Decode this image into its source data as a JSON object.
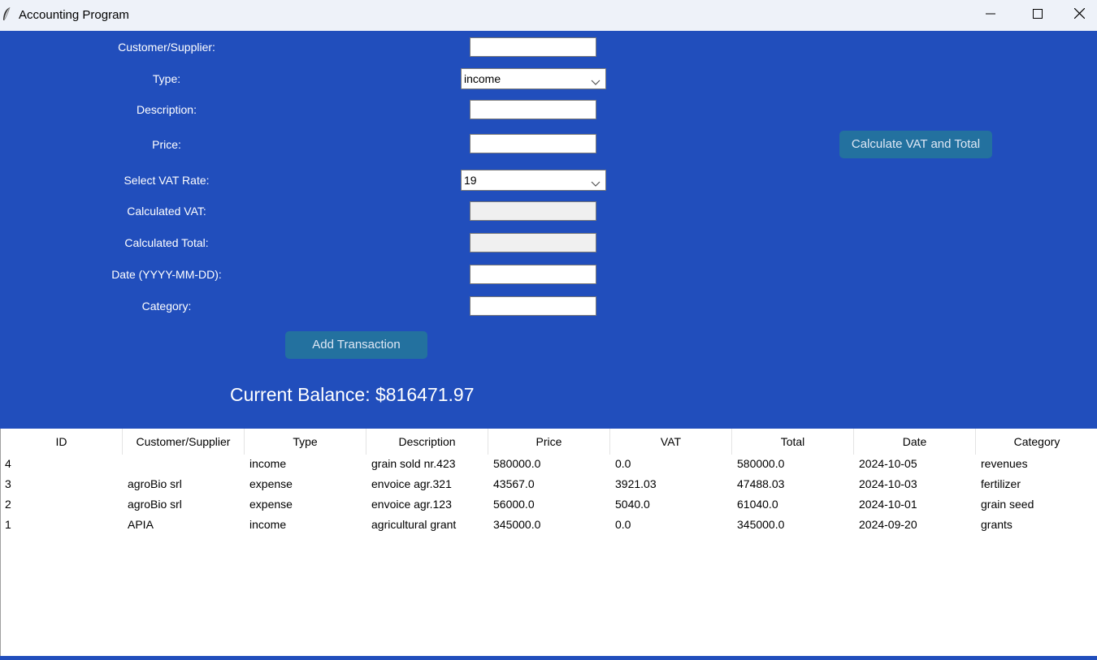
{
  "window": {
    "title": "Accounting Program",
    "icons": {
      "app": "feather-icon",
      "minimize": "minimize-icon",
      "maximize": "maximize-icon",
      "close": "close-icon"
    }
  },
  "colors": {
    "panel": "#214ebc",
    "button": "#23719f",
    "button_text": "#dfe8f5"
  },
  "form": {
    "customer_label": "Customer/Supplier:",
    "customer_value": "",
    "type_label": "Type:",
    "type_value": "income",
    "description_label": "Description:",
    "description_value": "",
    "price_label": "Price:",
    "price_value": "",
    "vat_rate_label": "Select VAT Rate:",
    "vat_rate_value": "19",
    "calc_vat_label": "Calculated VAT:",
    "calc_vat_value": "",
    "calc_total_label": "Calculated Total:",
    "calc_total_value": "",
    "date_label": "Date (YYYY-MM-DD):",
    "date_value": "",
    "category_label": "Category:",
    "category_value": "",
    "add_button": "Add Transaction",
    "calc_button": "Calculate VAT and Total",
    "balance": "Current Balance: $816471.97"
  },
  "table": {
    "columns": [
      "ID",
      "Customer/Supplier",
      "Type",
      "Description",
      "Price",
      "VAT",
      "Total",
      "Date",
      "Category"
    ],
    "rows": [
      [
        "4",
        "",
        "income",
        "grain sold nr.423",
        "580000.0",
        "0.0",
        "580000.0",
        "2024-10-05",
        "revenues"
      ],
      [
        "3",
        "agroBio srl",
        "expense",
        "envoice agr.321",
        "43567.0",
        "3921.03",
        "47488.03",
        "2024-10-03",
        "fertilizer"
      ],
      [
        "2",
        "agroBio srl",
        "expense",
        "envoice agr.123",
        "56000.0",
        "5040.0",
        "61040.0",
        "2024-10-01",
        "grain seed"
      ],
      [
        "1",
        "APIA",
        "income",
        "agricultural grant",
        "345000.0",
        "0.0",
        "345000.0",
        "2024-09-20",
        "grants"
      ]
    ]
  }
}
